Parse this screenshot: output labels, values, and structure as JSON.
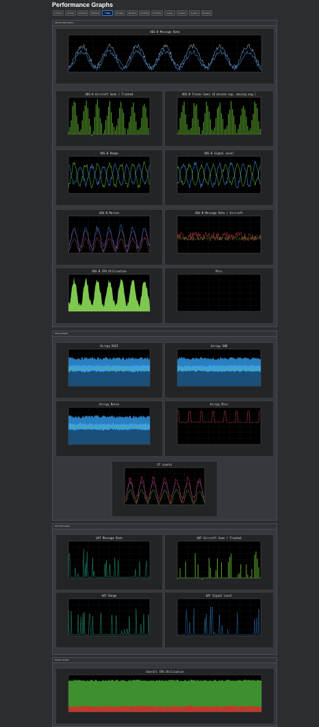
{
  "page": {
    "title": "Performance Graphs"
  },
  "range_buttons": [
    "1 hours",
    "6 hours",
    "24 hours",
    "48 hours",
    "7 days",
    "14 days",
    "30 days",
    "3 months",
    "6 months",
    "1 year",
    "2 years",
    "5 years",
    "10 years"
  ],
  "active_range": "7 days",
  "sections": {
    "adsb": {
      "header": "ADS-B 1090 Graphs"
    },
    "airspy": {
      "header": "Airspy Graphs"
    },
    "uat": {
      "header": "UAT 978 Graphs"
    },
    "system": {
      "header": "System Graphs"
    }
  },
  "graphs": {
    "adsb_message_rate": {
      "title": "ADS-B Message Rate"
    },
    "adsb_aircraft": {
      "title": "ADS-B Aircraft Seen / Tracked"
    },
    "adsb_tracks": {
      "title": "ADS-B Tracks Seen (8 minute exp. moving avg.)"
    },
    "adsb_range": {
      "title": "ADS-B Range"
    },
    "adsb_signal": {
      "title": "ADS-B Signal Level"
    },
    "adsb_marine": {
      "title": "ADS-B Marine"
    },
    "adsb_msg_aircraft": {
      "title": "ADS-B Message Rate / Aircraft"
    },
    "adsb_cpu": {
      "title": "ADS-B CPU Utilization"
    },
    "misc": {
      "title": "Misc"
    },
    "airspy_rssi": {
      "title": "Airspy RSSI"
    },
    "airspy_snr": {
      "title": "Airspy SNR"
    },
    "airspy_noise": {
      "title": "Airspy Noise"
    },
    "airspy_misc": {
      "title": "Airspy Misc"
    },
    "cf_counts": {
      "title": "CF counts"
    },
    "uat_msg_rate": {
      "title": "UAT Message Rate"
    },
    "uat_aircraft": {
      "title": "UAT Aircraft Seen / Tracked"
    },
    "uat_range": {
      "title": "UAT Range"
    },
    "uat_signal": {
      "title": "UAT Signal Level"
    },
    "cpu_overall": {
      "title": "Overall CPU Utilization"
    }
  }
}
